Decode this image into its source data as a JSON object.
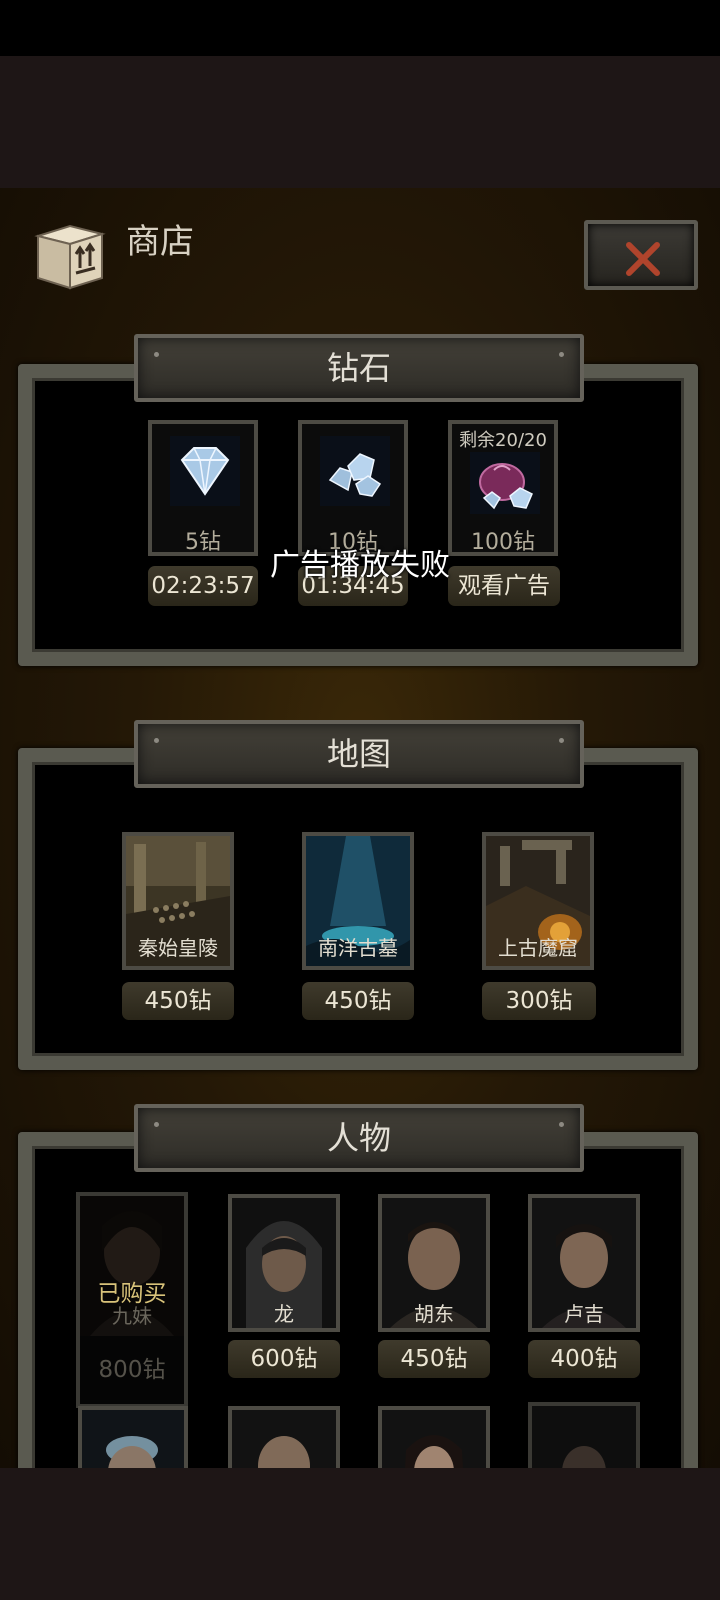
{
  "shop": {
    "title": "商店",
    "toast": "广告播放失败"
  },
  "sections": {
    "diamonds": {
      "title": "钻石",
      "items": [
        {
          "label": "5钻",
          "price": "02:23:57",
          "icon": "diamond-small-icon"
        },
        {
          "label": "10钻",
          "price": "01:34:45",
          "icon": "diamond-pile-icon"
        },
        {
          "label": "100钻",
          "price": "观看广告",
          "remaining": "剩余20/20",
          "icon": "diamond-bag-icon"
        }
      ]
    },
    "maps": {
      "title": "地图",
      "items": [
        {
          "label": "秦始皇陵",
          "price": "450钻"
        },
        {
          "label": "南洋古墓",
          "price": "450钻"
        },
        {
          "label": "上古魔窟",
          "price": "300钻"
        }
      ]
    },
    "characters": {
      "title": "人物",
      "items": [
        {
          "label": "九妹",
          "price": "800钻",
          "status": "已购买"
        },
        {
          "label": "龙",
          "price": "600钻"
        },
        {
          "label": "胡东",
          "price": "450钻"
        },
        {
          "label": "卢吉",
          "price": "400钻"
        }
      ]
    }
  },
  "colors": {
    "accent": "#c9b98a",
    "close_x": "#b0442c",
    "frame": "#5a5a50"
  }
}
